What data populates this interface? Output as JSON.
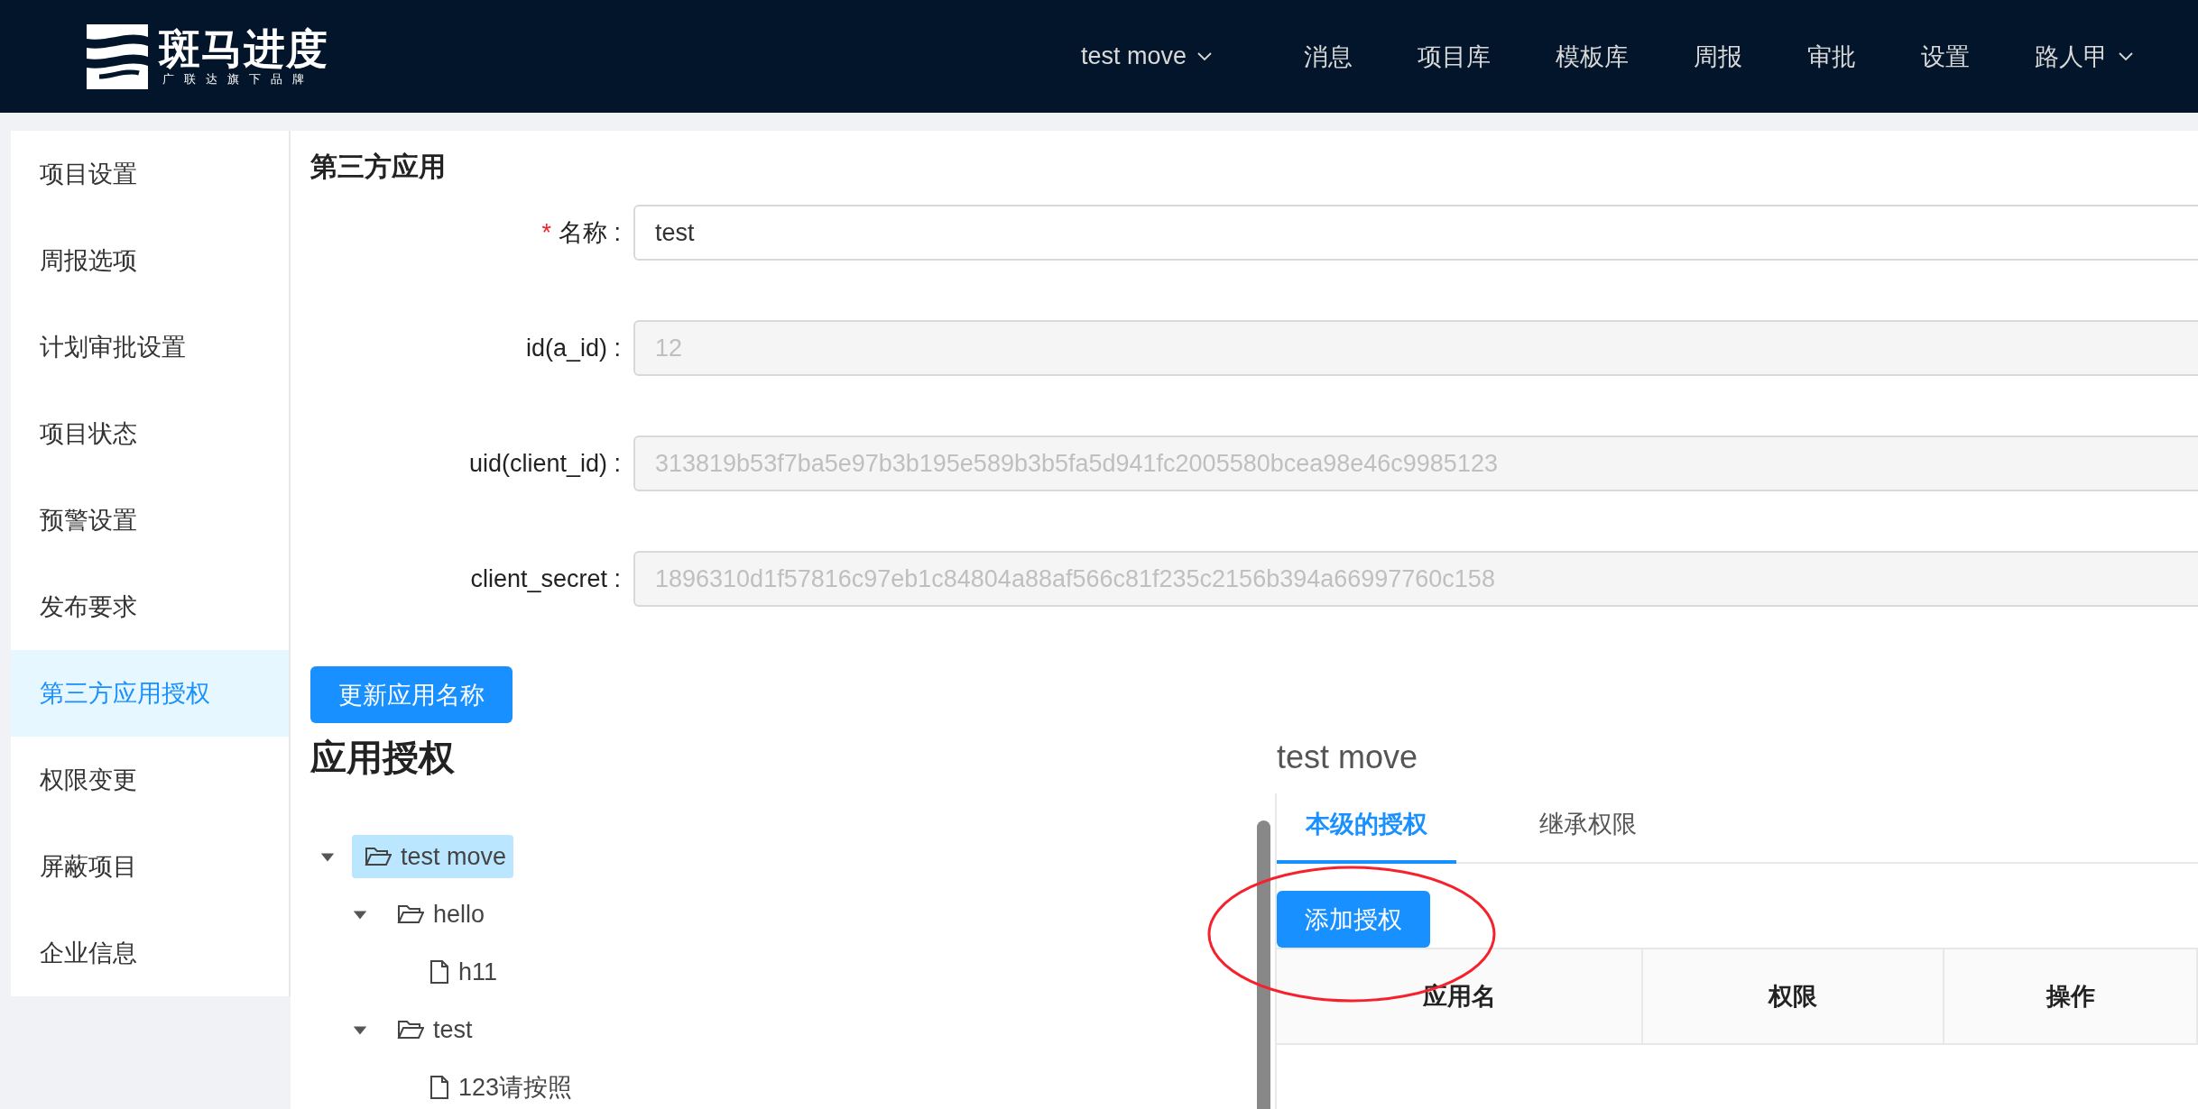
{
  "header": {
    "logo": {
      "name": "斑马进度",
      "tagline": "广联达旗下品牌"
    },
    "nav": [
      {
        "label": "test move",
        "dropdown": true
      },
      {
        "label": "消息",
        "dropdown": false
      },
      {
        "label": "项目库",
        "dropdown": false
      },
      {
        "label": "模板库",
        "dropdown": false
      },
      {
        "label": "周报",
        "dropdown": false
      },
      {
        "label": "审批",
        "dropdown": false
      },
      {
        "label": "设置",
        "dropdown": false
      },
      {
        "label": "路人甲",
        "dropdown": true
      }
    ]
  },
  "sidebar": {
    "items": [
      {
        "label": "项目设置",
        "selected": false
      },
      {
        "label": "周报选项",
        "selected": false
      },
      {
        "label": "计划审批设置",
        "selected": false
      },
      {
        "label": "项目状态",
        "selected": false
      },
      {
        "label": "预警设置",
        "selected": false
      },
      {
        "label": "发布要求",
        "selected": false
      },
      {
        "label": "第三方应用授权",
        "selected": true
      },
      {
        "label": "权限变更",
        "selected": false
      },
      {
        "label": "屏蔽项目",
        "selected": false
      },
      {
        "label": "企业信息",
        "selected": false
      }
    ]
  },
  "form": {
    "title": "第三方应用",
    "fields": [
      {
        "required_mark": "*",
        "label": "名称",
        "colon": ":",
        "value": "test",
        "disabled": false
      },
      {
        "label": "id(a_id)",
        "colon": ":",
        "value": "12",
        "disabled": true
      },
      {
        "label": "uid(client_id)",
        "colon": ":",
        "value": "313819b53f7ba5e97b3b195e589b3b5fa5d941fc2005580bcea98e46c9985123",
        "disabled": true
      },
      {
        "label": "client_secret",
        "colon": ":",
        "value": "1896310d1f57816c97eb1c84804a88af566c81f235c2156b394a66997760c158",
        "disabled": true
      }
    ],
    "button": "更新应用名称"
  },
  "auth": {
    "title": "应用授权",
    "tree": [
      {
        "label": "test move",
        "kind": "folder",
        "expanded": true,
        "selected": true,
        "children": [
          {
            "label": "hello",
            "kind": "folder",
            "expanded": true,
            "selected": false,
            "children": [
              {
                "label": "h11",
                "kind": "file",
                "selected": false
              }
            ]
          },
          {
            "label": "test",
            "kind": "folder",
            "expanded": true,
            "selected": false,
            "children": [
              {
                "label": "123请按照",
                "kind": "file",
                "selected": false
              }
            ]
          }
        ]
      }
    ],
    "detail": {
      "title": "test move",
      "tabs": [
        {
          "label": "本级的授权",
          "selected": true
        },
        {
          "label": "继承权限",
          "selected": false
        }
      ],
      "button": "添加授权",
      "columns": [
        "应用名",
        "权限",
        "操作"
      ]
    }
  }
}
